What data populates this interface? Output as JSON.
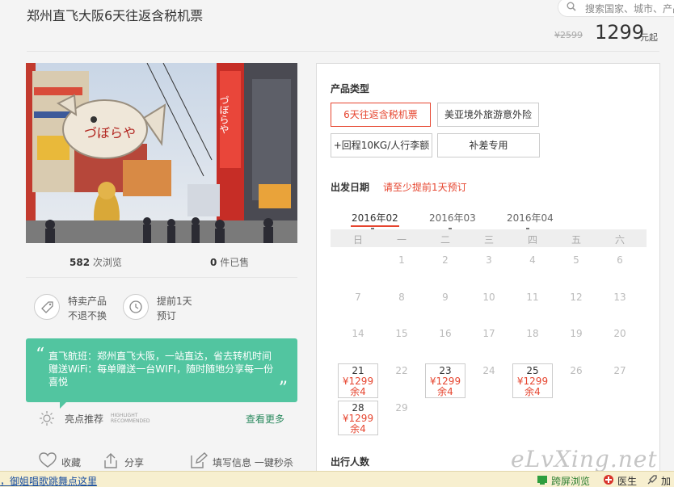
{
  "product": {
    "title": "郑州直飞大阪6天往返含税机票",
    "old_price": "¥2599",
    "price": "1299",
    "price_unit": "元起"
  },
  "search": {
    "placeholder": "搜索国家、城市、产品"
  },
  "stats": {
    "views": "582",
    "views_label": "次浏览",
    "sold": "0",
    "sold_label": "件已售"
  },
  "features": [
    {
      "icon": "tag-icon",
      "line1": "特卖产品",
      "line2": "不退不换"
    },
    {
      "icon": "clock-icon",
      "line1": "提前1天",
      "line2": "预订"
    }
  ],
  "quote": {
    "open": "“",
    "close": "”",
    "text": "直飞航班：郑州直飞大阪，一站直达，省去转机时间 赠送WiFi：每单赠送一台WIFI，随时随地分享每一份喜悦"
  },
  "highlight": {
    "title": "亮点推荐",
    "subtitle": "HIGHLIGHT RECOMMENDED",
    "more": "查看更多"
  },
  "actions": [
    {
      "icon": "heart-icon",
      "label": "收藏"
    },
    {
      "icon": "share-icon",
      "label": "分享"
    },
    {
      "icon": "edit-icon",
      "label": "填写信息 一键秒杀"
    }
  ],
  "panel": {
    "type_title": "产品类型",
    "types": [
      "6天往返含税机票",
      "美亚境外旅游意外险",
      "+回程10KG/人行李额",
      "补差专用"
    ],
    "date_title": "出发日期",
    "date_notice": "请至少提前1天预订",
    "months": [
      "2016年02",
      "2016年03",
      "2016年04"
    ],
    "weekdays": [
      "日",
      "一",
      "二",
      "三",
      "四",
      "五",
      "六"
    ],
    "calendar_rows": [
      [
        "",
        "1",
        "2",
        "3",
        "4",
        "5",
        "6"
      ],
      [
        "7",
        "8",
        "9",
        "10",
        "11",
        "12",
        "13"
      ],
      [
        "14",
        "15",
        "16",
        "17",
        "18",
        "19",
        "20"
      ],
      [
        "21",
        "22",
        "23",
        "24",
        "25",
        "26",
        "27"
      ],
      [
        "28",
        "29",
        "",
        "",
        "",
        "",
        ""
      ]
    ],
    "available": [
      {
        "day": "21",
        "price": "¥1299",
        "remain": "余4"
      },
      {
        "day": "23",
        "price": "¥1299",
        "remain": "余4"
      },
      {
        "day": "25",
        "price": "¥1299",
        "remain": "余4"
      },
      {
        "day": "28",
        "price": "¥1299",
        "remain": "余4"
      }
    ],
    "travelers_title": "出行人数"
  },
  "watermark": "eLvXing.net",
  "statusbar": {
    "link": "，御姐唱歌跳舞点这里",
    "items": [
      "跨屏浏览",
      "医生",
      "加"
    ]
  }
}
